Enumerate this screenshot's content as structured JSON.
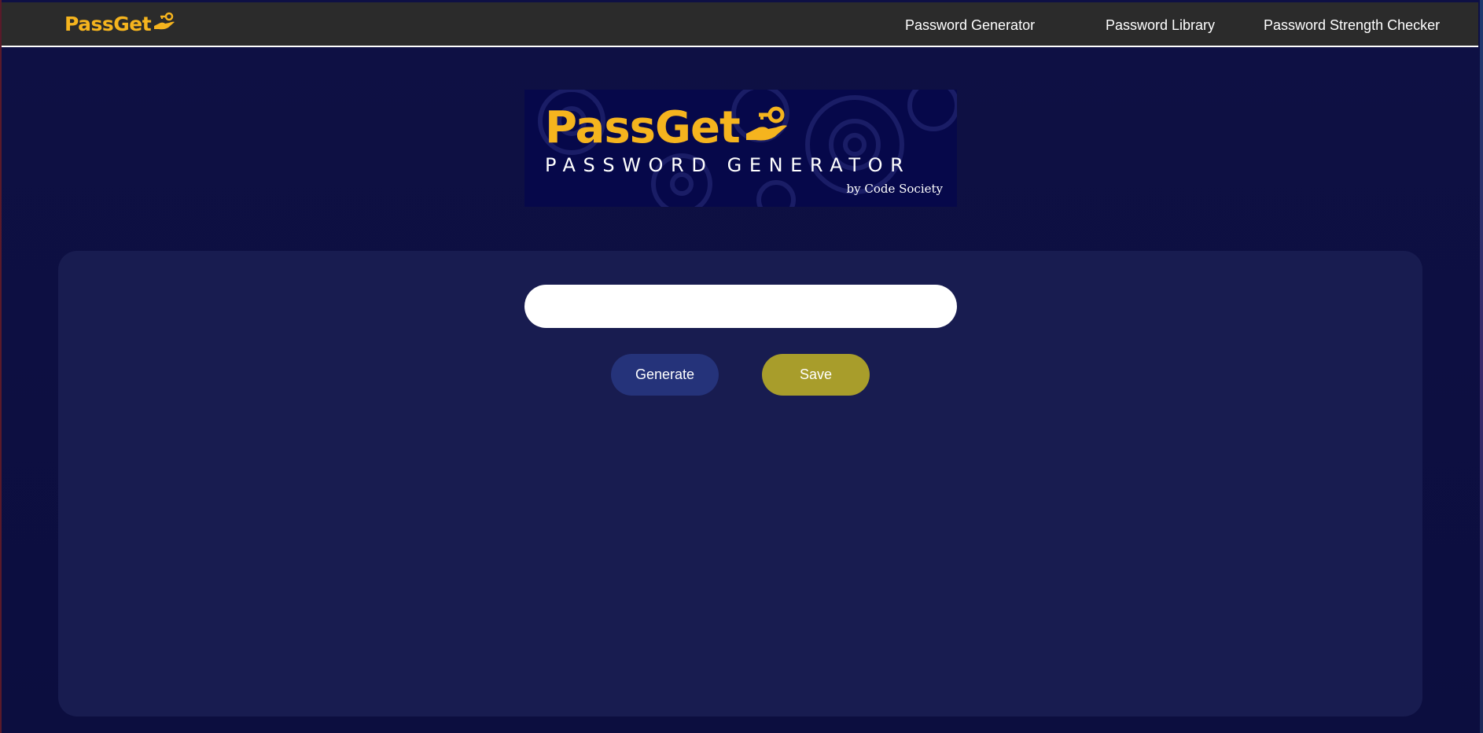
{
  "navbar": {
    "brand": "PassGet",
    "brand_icon": "key-in-hand-icon",
    "links": [
      {
        "label": "Password Generator"
      },
      {
        "label": "Password Library"
      },
      {
        "label": "Password Strength Checker"
      }
    ]
  },
  "banner": {
    "title": "PassGet",
    "subtitle": "PASSWORD GENERATOR",
    "byline": "by Code Society"
  },
  "generator": {
    "password_value": "",
    "generate_label": "Generate",
    "save_label": "Save"
  },
  "colors": {
    "accent_gold": "#f5b41e",
    "navbar_bg": "#2b2b2b",
    "page_bg": "#0e1044",
    "card_bg": "#181c50",
    "generate_button": "#25337a",
    "save_button": "#a89d2b"
  }
}
